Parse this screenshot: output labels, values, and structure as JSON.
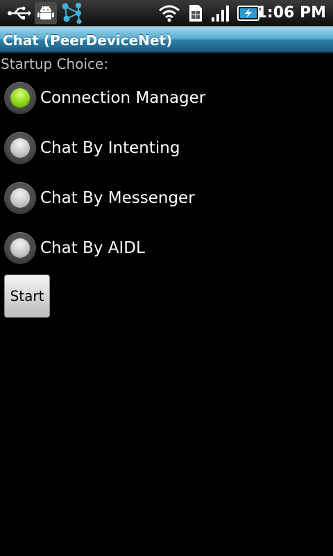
{
  "status_bar": {
    "time": "1:06 PM",
    "icons": [
      "usb-icon",
      "usb-debugging-icon",
      "network-share-icon",
      "wifi-icon",
      "sim-icon",
      "signal-icon",
      "battery-charging-icon"
    ]
  },
  "app": {
    "title": "Chat (PeerDeviceNet)"
  },
  "form": {
    "label": "Startup Choice:",
    "options": [
      {
        "label": "Connection Manager",
        "selected": true
      },
      {
        "label": "Chat By Intenting",
        "selected": false
      },
      {
        "label": "Chat By Messenger",
        "selected": false
      },
      {
        "label": "Chat By AIDL",
        "selected": false
      }
    ],
    "start_label": "Start"
  },
  "colors": {
    "accent_radio": "#8fd41a",
    "title_bar": "#5aaed0",
    "background": "#000000"
  }
}
